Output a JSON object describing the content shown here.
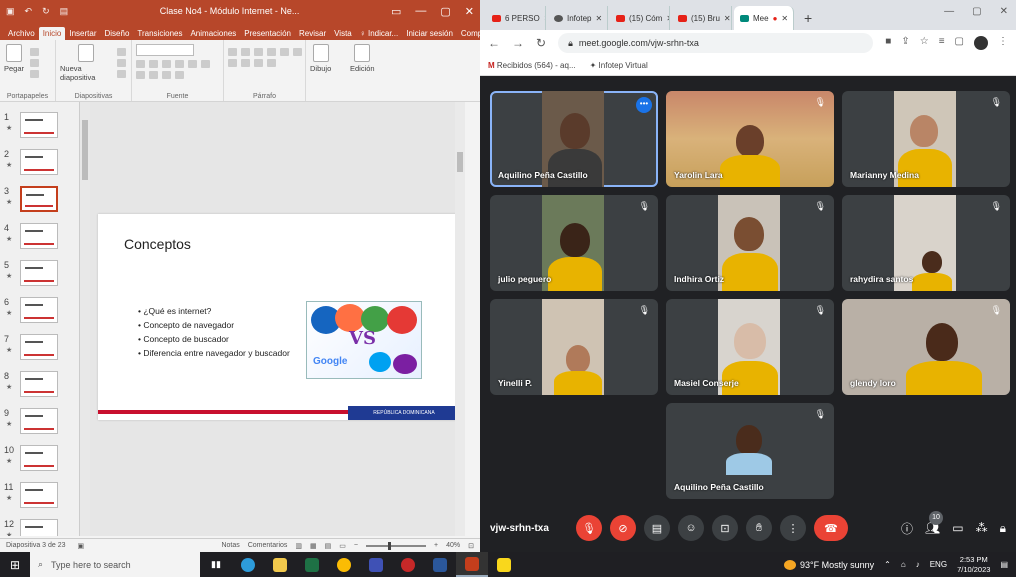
{
  "ppt": {
    "window_title": "Clase No4 - Módulo Internet - Ne...",
    "tabs": [
      "Archivo",
      "Inicio",
      "Insertar",
      "Diseño",
      "Transiciones",
      "Animaciones",
      "Presentación",
      "Revisar",
      "Vista",
      "♀ Indicar...",
      "Iniciar sesión",
      "Compartir"
    ],
    "ribbon": {
      "paste_label": "Pegar",
      "new_slide_label": "Nueva diapositiva",
      "drawing_label": "Dibujo",
      "editing_label": "Edición",
      "groups": [
        "Portapapeles",
        "Diapositivas",
        "Fuente",
        "Párrafo"
      ]
    },
    "thumbnails": [
      "1",
      "2",
      "3",
      "4",
      "5",
      "6",
      "7",
      "8",
      "9",
      "10",
      "11",
      "12"
    ],
    "selected_thumb": 3,
    "slide": {
      "title": "Conceptos",
      "bullets": [
        "¿Qué es internet?",
        "Concepto de navegador",
        "Concepto de buscador",
        "Diferencia entre navegador y buscador"
      ],
      "art_vs": "VS",
      "art_google": "Google",
      "footer_org": "REPÚBLICA DOMINICANA"
    },
    "status": {
      "slide_info": "Diapositiva 3 de 23",
      "notes": "Notas",
      "comments": "Comentarios",
      "zoom": "40%"
    }
  },
  "chrome": {
    "tabs": [
      {
        "label": "6 PERSO",
        "icon": "youtube-icon"
      },
      {
        "label": "Infotep",
        "icon": "github-icon"
      },
      {
        "label": "(15) Cóm",
        "icon": "youtube-icon"
      },
      {
        "label": "(15) Bru",
        "icon": "youtube-icon"
      },
      {
        "label": "Mee",
        "icon": "meet-icon"
      }
    ],
    "url": "meet.google.com/vjw-srhn-txa",
    "bookmarks": [
      "Recibidos (564) - aq...",
      "Infotep Virtual"
    ]
  },
  "meet": {
    "participants": [
      {
        "name": "Aquilino Peña Castillo",
        "speaker": true
      },
      {
        "name": "Yarolin Lara"
      },
      {
        "name": "Marianny Medina"
      },
      {
        "name": "julio peguero"
      },
      {
        "name": "Indhira Ortiz"
      },
      {
        "name": "rahydira santos"
      },
      {
        "name": "Yinelli P."
      },
      {
        "name": "Masiel Conserje"
      },
      {
        "name": "glendy loro"
      },
      {
        "name": "Aquilino Peña Castillo"
      }
    ],
    "meeting_code": "vjw-srhn-txa",
    "people_count": "10",
    "banner": "GOBIERNO DE LA"
  },
  "taskbar": {
    "search_placeholder": "Type here to search",
    "weather": "93°F  Mostly sunny",
    "lang": "ENG",
    "time": "2:53 PM",
    "date": "7/10/2023"
  },
  "colors": {
    "ppt_accent": "#b7472a",
    "meet_bg": "#202124",
    "end_call": "#ea4335",
    "speaker_outline": "#8ab4f8"
  }
}
